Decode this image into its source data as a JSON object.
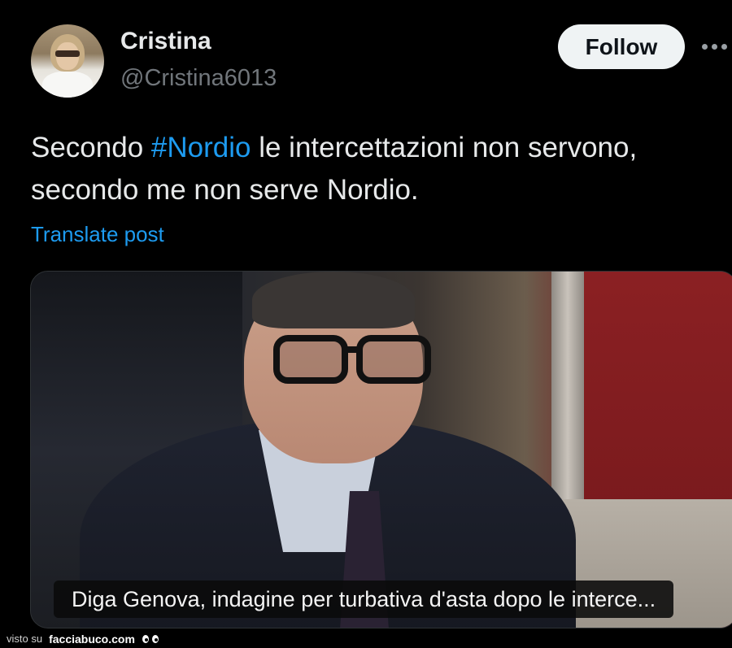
{
  "author": {
    "display_name": "Cristina",
    "handle": "@Cristina6013"
  },
  "actions": {
    "follow_label": "Follow",
    "more_icon": "more-horizontal-icon"
  },
  "post": {
    "text_before": "Secondo ",
    "hashtag": "#Nordio",
    "text_after": " le intercettazioni non servono, secondo me non serve Nordio.",
    "translate_label": "Translate post"
  },
  "media": {
    "caption": "Diga Genova, indagine per turbativa d'asta dopo le interce..."
  },
  "watermark": {
    "prefix": "visto su",
    "site": "facciabuco.com"
  },
  "colors": {
    "background": "#000000",
    "link": "#1d9bf0",
    "text": "#e7e9ea",
    "secondary": "#71767b"
  }
}
